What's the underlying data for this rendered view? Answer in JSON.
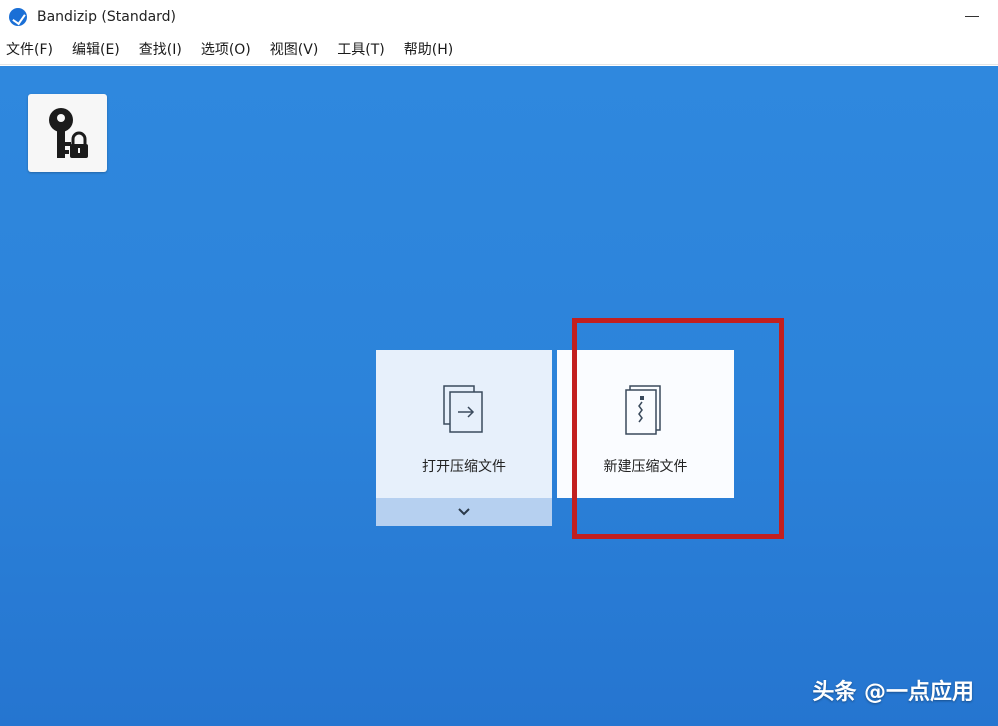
{
  "window": {
    "title": "Bandizip (Standard)"
  },
  "menu": {
    "items": [
      "文件(F)",
      "编辑(E)",
      "查找(I)",
      "选项(O)",
      "视图(V)",
      "工具(T)",
      "帮助(H)"
    ]
  },
  "toolbar": {
    "key_tile_icon": "key-lock-icon"
  },
  "cards": {
    "open": {
      "label": "打开压缩文件",
      "icon": "open-archive-icon",
      "dropdown_icon": "chevron-down-icon"
    },
    "new": {
      "label": "新建压缩文件",
      "icon": "new-archive-icon"
    }
  },
  "highlight": {
    "color": "#c21f1f"
  },
  "watermark": {
    "text": "头条 @一点应用"
  },
  "colors": {
    "background": "#2c83da",
    "card_open": "#e7f0fb",
    "card_new": "#fafcff",
    "dropdown_strip": "#b6d0f0"
  }
}
